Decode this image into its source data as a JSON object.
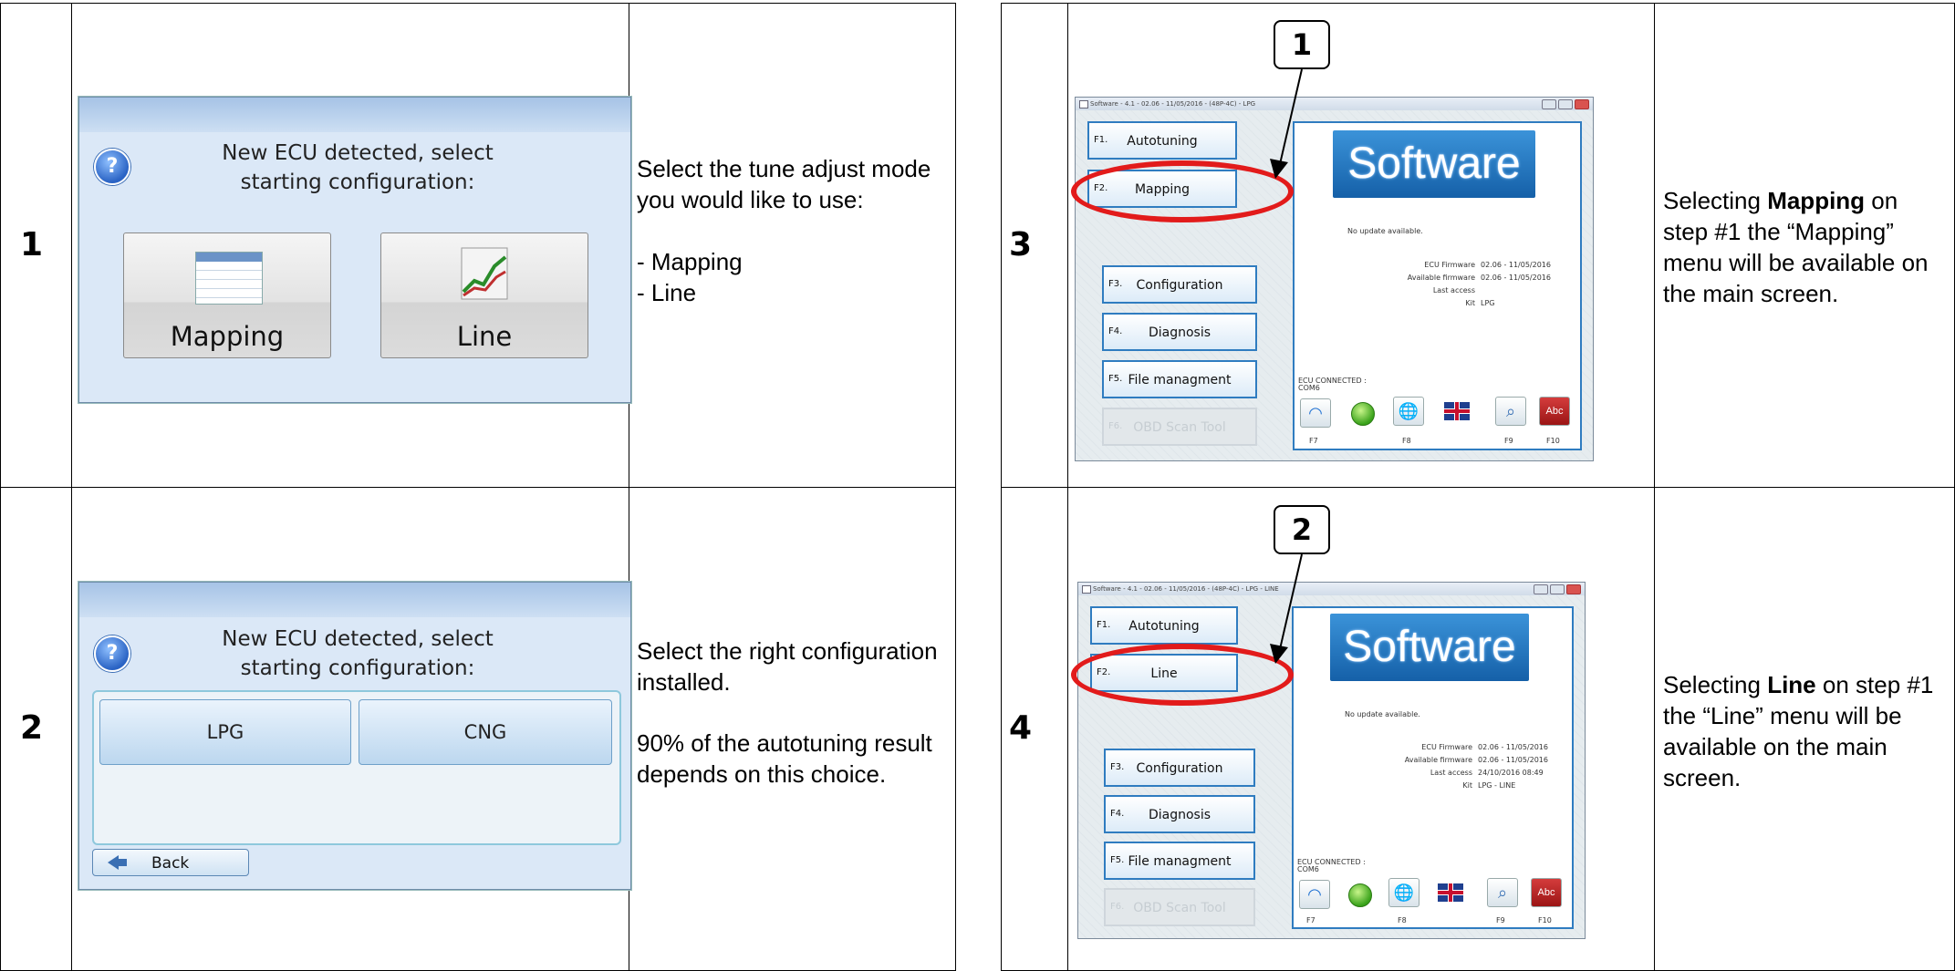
{
  "steps": [
    {
      "number": "1",
      "dialog": {
        "title": "New ECU detected, select starting configuration:",
        "buttons": [
          "Mapping",
          "Line"
        ]
      },
      "description": "Select the tune adjust mode you would like to use:\n\n- Mapping\n- Line"
    },
    {
      "number": "2",
      "dialog": {
        "title": "New ECU detected, select starting configuration:",
        "buttons": [
          "LPG",
          "CNG"
        ],
        "back_label": "Back"
      },
      "description_parts": [
        "Select the right configuration installed.",
        "90% of the autotuning result depends on this choice."
      ]
    },
    {
      "number": "3",
      "callout": "1",
      "description": {
        "pre": "Selecting ",
        "bold": "Mapping",
        "post": " on step #1 the “Mapping” menu will be available on the main screen."
      },
      "screen": {
        "window_title": "Software - 4.1 - 02.06 - 11/05/2016 - (48P-4C) - LPG",
        "buttons": [
          {
            "key": "F1.",
            "label": "Autotuning"
          },
          {
            "key": "F2.",
            "label": "Mapping"
          },
          {
            "key": "F3.",
            "label": "Configuration"
          },
          {
            "key": "F4.",
            "label": "Diagnosis"
          },
          {
            "key": "F5.",
            "label": "File managment"
          },
          {
            "key": "F6.",
            "label": "OBD Scan Tool"
          }
        ],
        "logo": "Software",
        "update": "No update available.",
        "info_labels": [
          "ECU Firmware",
          "Available firmware",
          "Last access",
          "Kit"
        ],
        "info_values": [
          "02.06 - 11/05/2016",
          "02.06 - 11/05/2016",
          "",
          "LPG"
        ],
        "status": "ECU   CONNECTED   :",
        "port": "COM6",
        "fkeys": [
          "F7",
          "F8",
          "F9",
          "F10"
        ]
      }
    },
    {
      "number": "4",
      "callout": "2",
      "description": {
        "pre": "Selecting ",
        "bold": "Line",
        "post": " on step #1 the “Line” menu will be available on the main screen."
      },
      "screen": {
        "window_title": "Software - 4.1 - 02.06 - 11/05/2016 - (48P-4C) - LPG - LINE",
        "buttons": [
          {
            "key": "F1.",
            "label": "Autotuning"
          },
          {
            "key": "F2.",
            "label": "Line"
          },
          {
            "key": "F3.",
            "label": "Configuration"
          },
          {
            "key": "F4.",
            "label": "Diagnosis"
          },
          {
            "key": "F5.",
            "label": "File managment"
          },
          {
            "key": "F6.",
            "label": "OBD Scan Tool"
          }
        ],
        "logo": "Software",
        "update": "No update available.",
        "info_labels": [
          "ECU Firmware",
          "Available firmware",
          "Last access",
          "Kit"
        ],
        "info_values": [
          "02.06 - 11/05/2016",
          "02.06 - 11/05/2016",
          "24/10/2016 08:49",
          "LPG - LINE"
        ],
        "status": "ECU   CONNECTED   :",
        "port": "COM6",
        "fkeys": [
          "F7",
          "F8",
          "F9",
          "F10"
        ]
      }
    }
  ],
  "colors": {
    "ring": "#e21b1b",
    "panel_border": "#2f7cc0"
  }
}
